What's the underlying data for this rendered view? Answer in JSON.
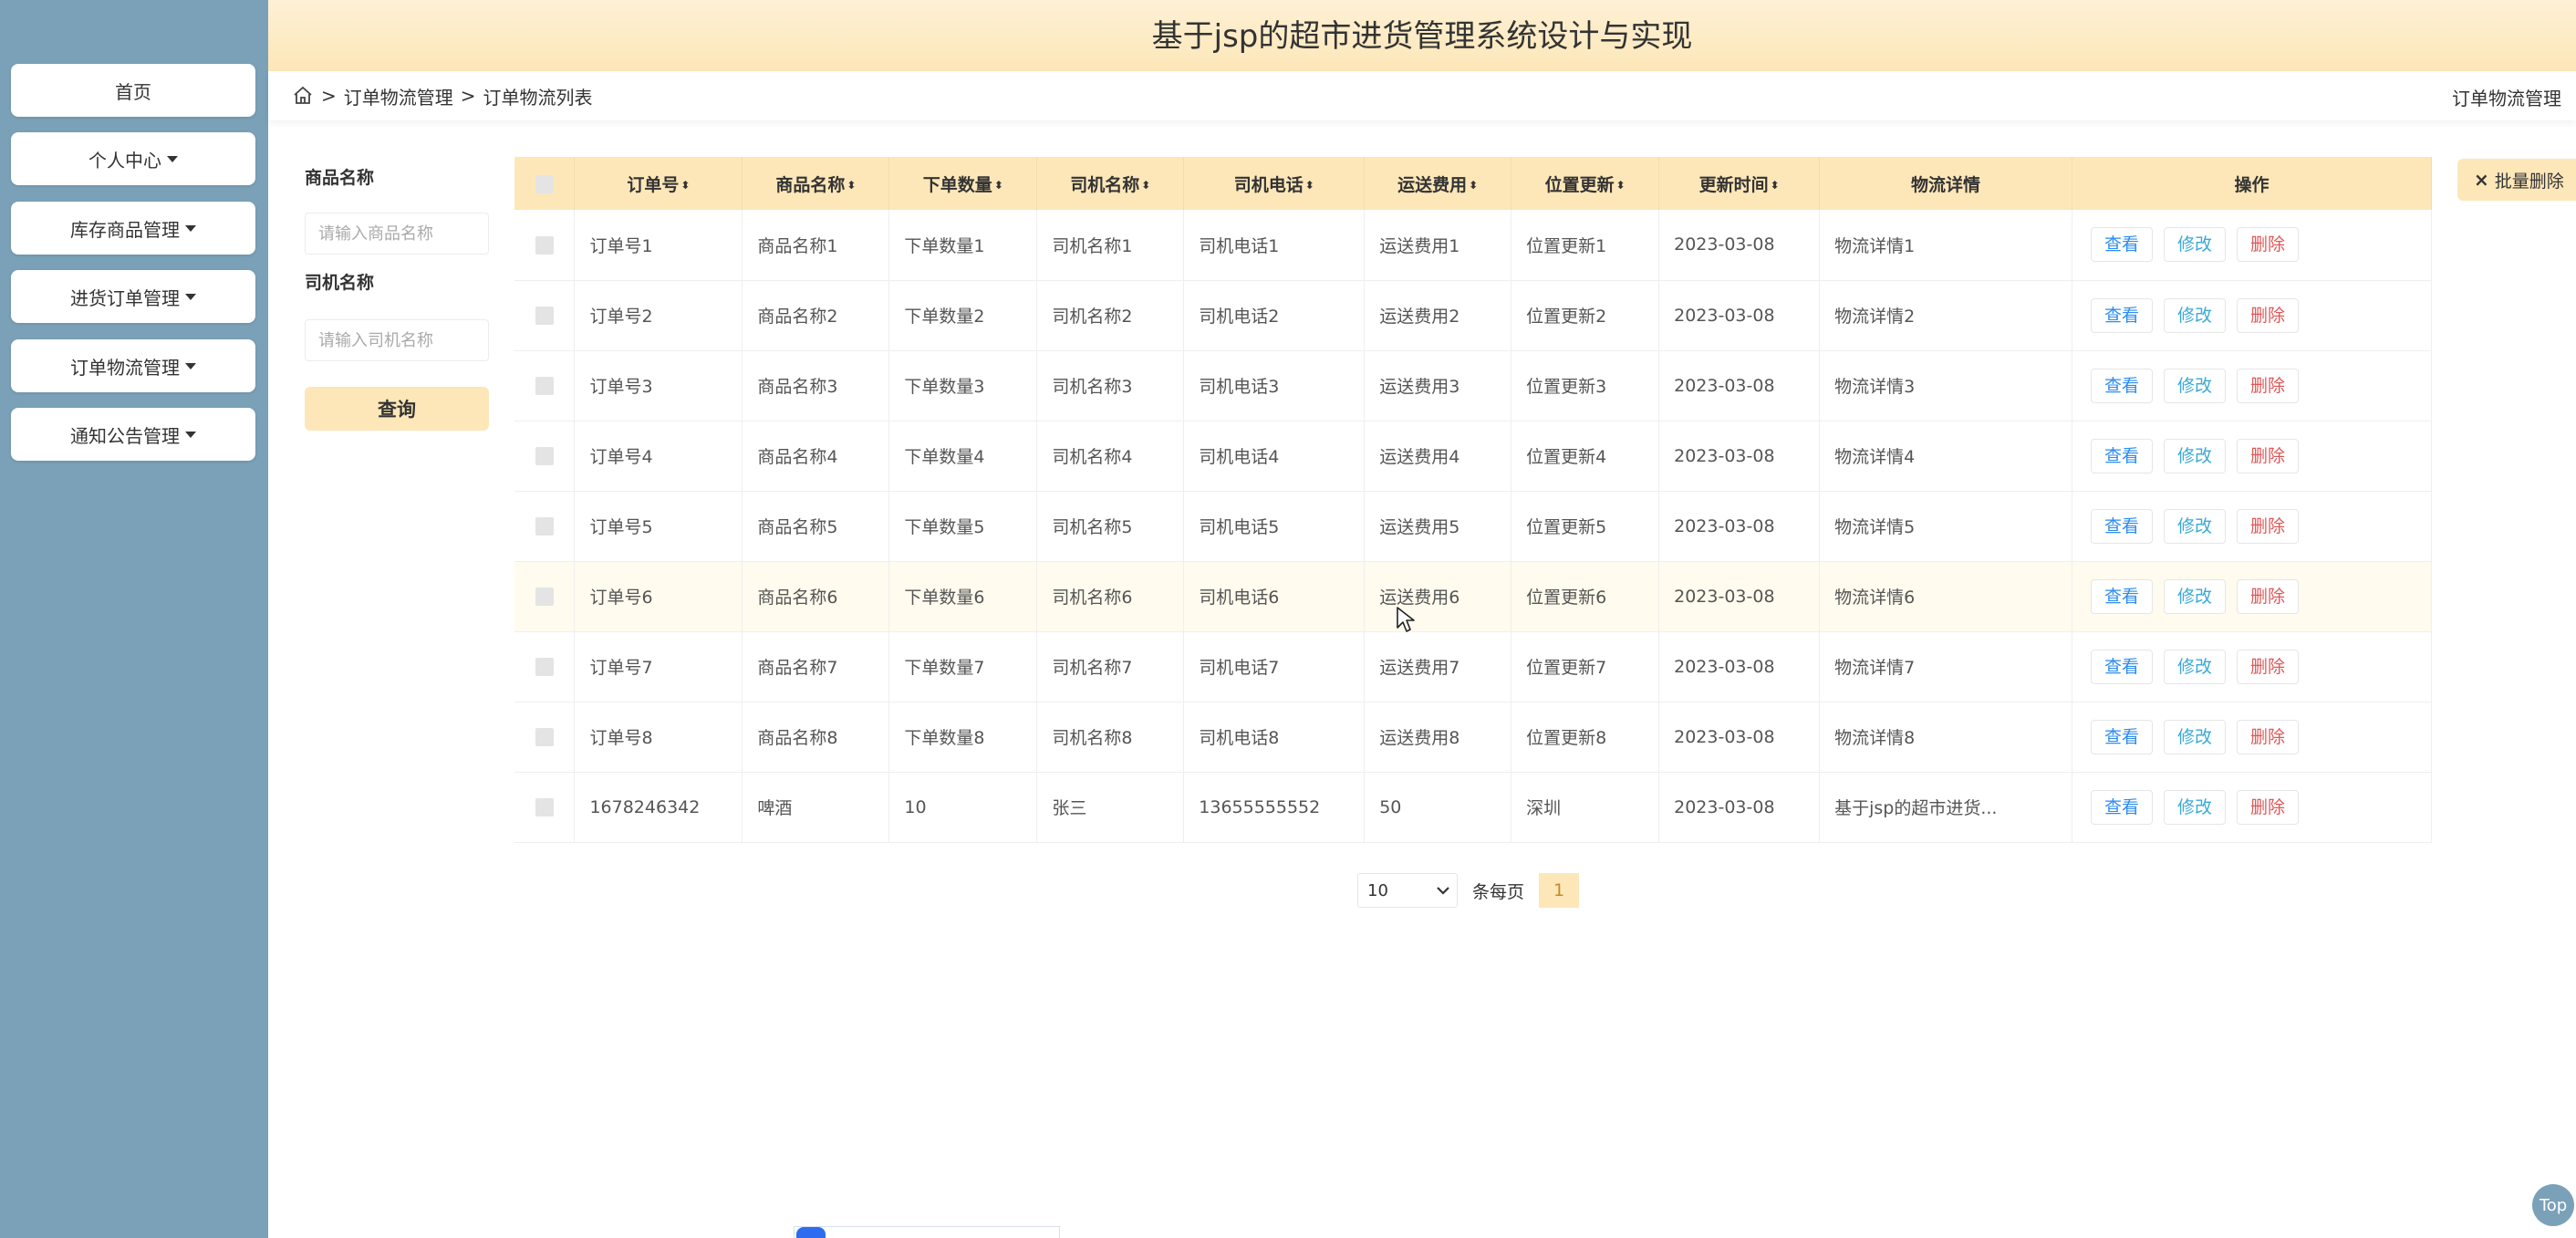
{
  "app": {
    "title": "基于jsp的超市进货管理系统设计与实现"
  },
  "sidebar": {
    "items": [
      {
        "label": "首页",
        "has_caret": false
      },
      {
        "label": "个人中心",
        "has_caret": true
      },
      {
        "label": "库存商品管理",
        "has_caret": true
      },
      {
        "label": "进货订单管理",
        "has_caret": true
      },
      {
        "label": "订单物流管理",
        "has_caret": true
      },
      {
        "label": "通知公告管理",
        "has_caret": true
      }
    ]
  },
  "header": {
    "expand_icon": "fullscreen-icon",
    "user_icon": "user-icon"
  },
  "breadcrumb": {
    "home_icon": "home-icon",
    "sep": ">",
    "items": [
      "订单物流管理",
      "订单物流列表"
    ],
    "right_label": "订单物流管理"
  },
  "search": {
    "goods_label": "商品名称",
    "goods_placeholder": "请输入商品名称",
    "driver_label": "司机名称",
    "driver_placeholder": "请输入司机名称",
    "query_label": "查询"
  },
  "actions": {
    "batch_delete_label": "批量删除",
    "batch_delete_icon": "×"
  },
  "table": {
    "sort_glyph": "⬍",
    "columns": [
      {
        "label": "订单号",
        "sortable": true
      },
      {
        "label": "商品名称",
        "sortable": true
      },
      {
        "label": "下单数量",
        "sortable": true
      },
      {
        "label": "司机名称",
        "sortable": true
      },
      {
        "label": "司机电话",
        "sortable": true
      },
      {
        "label": "运送费用",
        "sortable": true
      },
      {
        "label": "位置更新",
        "sortable": true
      },
      {
        "label": "更新时间",
        "sortable": true
      },
      {
        "label": "物流详情",
        "sortable": false
      },
      {
        "label": "操作",
        "sortable": false
      }
    ],
    "op_labels": {
      "view": "查看",
      "edit": "修改",
      "delete": "删除"
    },
    "rows": [
      {
        "cells": [
          "订单号1",
          "商品名称1",
          "下单数量1",
          "司机名称1",
          "司机电话1",
          "运送费用1",
          "位置更新1",
          "2023-03-08",
          "物流详情1"
        ],
        "highlighted": false
      },
      {
        "cells": [
          "订单号2",
          "商品名称2",
          "下单数量2",
          "司机名称2",
          "司机电话2",
          "运送费用2",
          "位置更新2",
          "2023-03-08",
          "物流详情2"
        ],
        "highlighted": false
      },
      {
        "cells": [
          "订单号3",
          "商品名称3",
          "下单数量3",
          "司机名称3",
          "司机电话3",
          "运送费用3",
          "位置更新3",
          "2023-03-08",
          "物流详情3"
        ],
        "highlighted": false
      },
      {
        "cells": [
          "订单号4",
          "商品名称4",
          "下单数量4",
          "司机名称4",
          "司机电话4",
          "运送费用4",
          "位置更新4",
          "2023-03-08",
          "物流详情4"
        ],
        "highlighted": false
      },
      {
        "cells": [
          "订单号5",
          "商品名称5",
          "下单数量5",
          "司机名称5",
          "司机电话5",
          "运送费用5",
          "位置更新5",
          "2023-03-08",
          "物流详情5"
        ],
        "highlighted": false
      },
      {
        "cells": [
          "订单号6",
          "商品名称6",
          "下单数量6",
          "司机名称6",
          "司机电话6",
          "运送费用6",
          "位置更新6",
          "2023-03-08",
          "物流详情6"
        ],
        "highlighted": true
      },
      {
        "cells": [
          "订单号7",
          "商品名称7",
          "下单数量7",
          "司机名称7",
          "司机电话7",
          "运送费用7",
          "位置更新7",
          "2023-03-08",
          "物流详情7"
        ],
        "highlighted": false
      },
      {
        "cells": [
          "订单号8",
          "商品名称8",
          "下单数量8",
          "司机名称8",
          "司机电话8",
          "运送费用8",
          "位置更新8",
          "2023-03-08",
          "物流详情8"
        ],
        "highlighted": false
      },
      {
        "cells": [
          "1678246342",
          "啤酒",
          "10",
          "张三",
          "13655555552",
          "50",
          "深圳",
          "2023-03-08",
          "基于jsp的超市进货..."
        ],
        "highlighted": false
      }
    ]
  },
  "pagination": {
    "page_size": "10",
    "per_page_label": "条每页",
    "current_page": "1"
  },
  "misc": {
    "top_button": "Top"
  },
  "colors": {
    "sidebar": "#7aa1b8",
    "accent": "#fde7b9",
    "view": "#2d8cf0",
    "edit": "#3aa9d6",
    "delete": "#e05757"
  }
}
